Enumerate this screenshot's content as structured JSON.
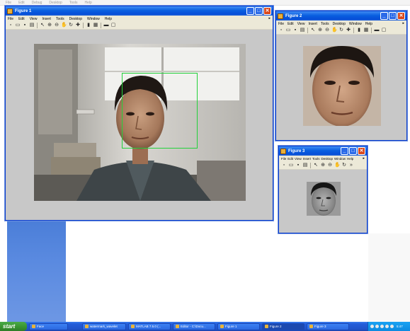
{
  "desktop": {
    "top_menu": [
      "File",
      "Edit",
      "Debug",
      "Desktop",
      "Tools",
      "Help"
    ]
  },
  "figure1": {
    "title": "Figure 1",
    "menu": [
      "File",
      "Edit",
      "View",
      "Insert",
      "Tools",
      "Desktop",
      "Window",
      "Help"
    ]
  },
  "figure2": {
    "title": "Figure 2",
    "menu": [
      "File",
      "Edit",
      "View",
      "Insert",
      "Tools",
      "Desktop",
      "Window",
      "Help"
    ]
  },
  "figure3": {
    "title": "Figure 3",
    "menu": [
      "File",
      "Edit",
      "View",
      "Insert",
      "Tools",
      "Desktop",
      "Window",
      "Help"
    ]
  },
  "taskbar": {
    "start_label": "start",
    "items": [
      "Face",
      "watermark_wavelet",
      "MATLAB 7.5.0 (...",
      "Editor - C:\\Docu...",
      "Figure 1",
      "Figure 2",
      "Figure 3"
    ],
    "clock": "5:47"
  },
  "colors": {
    "title_bar": "#0a5fe0",
    "detection_box": "#22d13a",
    "figure_background": "#c8c8c8",
    "taskbar": "#245edb",
    "start_button": "#37922f"
  },
  "icons": [
    "new-file-icon",
    "open-icon",
    "save-icon",
    "print-icon",
    "pointer-icon",
    "zoom-in-icon",
    "zoom-out-icon",
    "pan-icon",
    "rotate-icon",
    "data-cursor-icon",
    "colorbar-icon",
    "legend-icon",
    "plot-tools-icon"
  ]
}
